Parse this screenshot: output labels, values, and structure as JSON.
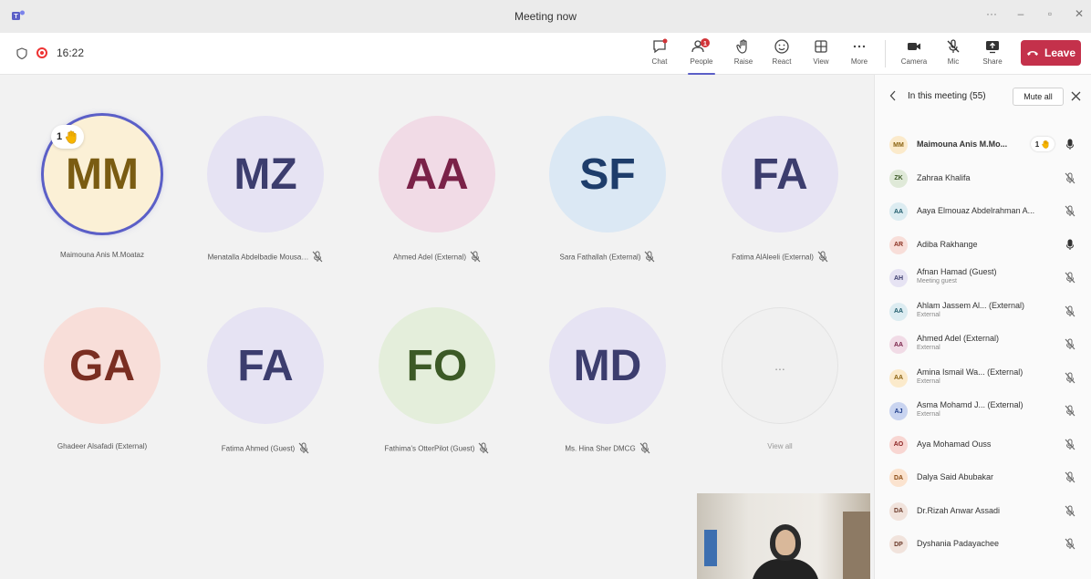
{
  "window": {
    "title": "Meeting now"
  },
  "toolbar": {
    "time": "16:22",
    "chat_label": "Chat",
    "people_label": "People",
    "people_badge": "1",
    "raise_label": "Raise",
    "react_label": "React",
    "view_label": "View",
    "more_label": "More",
    "camera_label": "Camera",
    "mic_label": "Mic",
    "share_label": "Share",
    "leave_label": "Leave"
  },
  "stage": {
    "hand_count": "1",
    "tiles": [
      {
        "initials": "MM",
        "name": "Maimouna Anis M.Moataz",
        "bg": "#fbf0d6",
        "fg": "#7a5c12",
        "muted": false
      },
      {
        "initials": "MZ",
        "name": "Menatalla Abdelbadie Mousa…",
        "bg": "#e6e3f3",
        "fg": "#3c3d6e",
        "muted": true
      },
      {
        "initials": "AA",
        "name": "Ahmed Adel (External)",
        "bg": "#f1dbe6",
        "fg": "#7a2248",
        "muted": true
      },
      {
        "initials": "SF",
        "name": "Sara Fathallah (External)",
        "bg": "#dbe8f4",
        "fg": "#1e3d6b",
        "muted": true
      },
      {
        "initials": "FA",
        "name": "Fatima AlAleeli (External)",
        "bg": "#e6e3f3",
        "fg": "#3c3d6e",
        "muted": true
      },
      {
        "initials": "GA",
        "name": "Ghadeer Alsafadi (External)",
        "bg": "#f8ded9",
        "fg": "#7a2e22",
        "muted": false
      },
      {
        "initials": "FA",
        "name": "Fatima Ahmed (Guest)",
        "bg": "#e6e3f3",
        "fg": "#3c3d6e",
        "muted": true
      },
      {
        "initials": "FO",
        "name": "Fathima's OtterPilot (Guest)",
        "bg": "#e4eedb",
        "fg": "#3c5a26",
        "muted": true
      },
      {
        "initials": "MD",
        "name": "Ms. Hina Sher DMCG",
        "bg": "#e6e3f3",
        "fg": "#3c3d6e",
        "muted": true
      }
    ],
    "view_all_dots": "...",
    "view_all_label": "View all"
  },
  "panel": {
    "title": "In this meeting (55)",
    "mute_all_label": "Mute all",
    "participants": [
      {
        "initials": "MM",
        "name": "Maimouna Anis M.Mo...",
        "sub": "",
        "bg": "#fbeacb",
        "fg": "#8a6212",
        "hand": "1",
        "mic": "on",
        "bold": true
      },
      {
        "initials": "ZK",
        "name": "Zahraa Khalifa",
        "sub": "",
        "bg": "#dfe9d8",
        "fg": "#3c5a26",
        "hand": "",
        "mic": "muted",
        "bold": false
      },
      {
        "initials": "AA",
        "name": "Aaya Elmouaz Abdelrahman A...",
        "sub": "",
        "bg": "#dcecf1",
        "fg": "#1e5a6b",
        "hand": "",
        "mic": "muted",
        "bold": false
      },
      {
        "initials": "AR",
        "name": "Adiba Rakhange",
        "sub": "",
        "bg": "#f8ded9",
        "fg": "#8a3222",
        "hand": "",
        "mic": "on",
        "bold": false
      },
      {
        "initials": "AH",
        "name": "Afnan Hamad (Guest)",
        "sub": "Meeting guest",
        "bg": "#e6e3f3",
        "fg": "#3c3d6e",
        "hand": "",
        "mic": "muted",
        "bold": false
      },
      {
        "initials": "AA",
        "name": "Ahlam Jassem Al... (External)",
        "sub": "External",
        "bg": "#dcecf1",
        "fg": "#1e5a6b",
        "hand": "",
        "mic": "muted",
        "bold": false
      },
      {
        "initials": "AA",
        "name": "Ahmed Adel (External)",
        "sub": "External",
        "bg": "#f1dbe6",
        "fg": "#7a2248",
        "hand": "",
        "mic": "muted",
        "bold": false
      },
      {
        "initials": "AA",
        "name": "Amina Ismail Wa... (External)",
        "sub": "External",
        "bg": "#fbeacb",
        "fg": "#8a6212",
        "hand": "",
        "mic": "muted",
        "bold": false
      },
      {
        "initials": "AJ",
        "name": "Asma Mohamd J... (External)",
        "sub": "External",
        "bg": "#c9d4f0",
        "fg": "#1e3d8a",
        "hand": "",
        "mic": "muted",
        "bold": false
      },
      {
        "initials": "AO",
        "name": "Aya Mohamad Ouss",
        "sub": "",
        "bg": "#f8d6d2",
        "fg": "#8a2222",
        "hand": "",
        "mic": "muted",
        "bold": false
      },
      {
        "initials": "DA",
        "name": "Dalya Said Abubakar",
        "sub": "",
        "bg": "#fbe3cf",
        "fg": "#8a4a12",
        "hand": "",
        "mic": "muted",
        "bold": false
      },
      {
        "initials": "DA",
        "name": "Dr.Rizah Anwar Assadi",
        "sub": "",
        "bg": "#f1e3dc",
        "fg": "#6b3a2a",
        "hand": "",
        "mic": "muted",
        "bold": false
      },
      {
        "initials": "DP",
        "name": "Dyshania Padayachee",
        "sub": "",
        "bg": "#f1e3dc",
        "fg": "#6b3a2a",
        "hand": "",
        "mic": "muted",
        "bold": false
      }
    ]
  }
}
